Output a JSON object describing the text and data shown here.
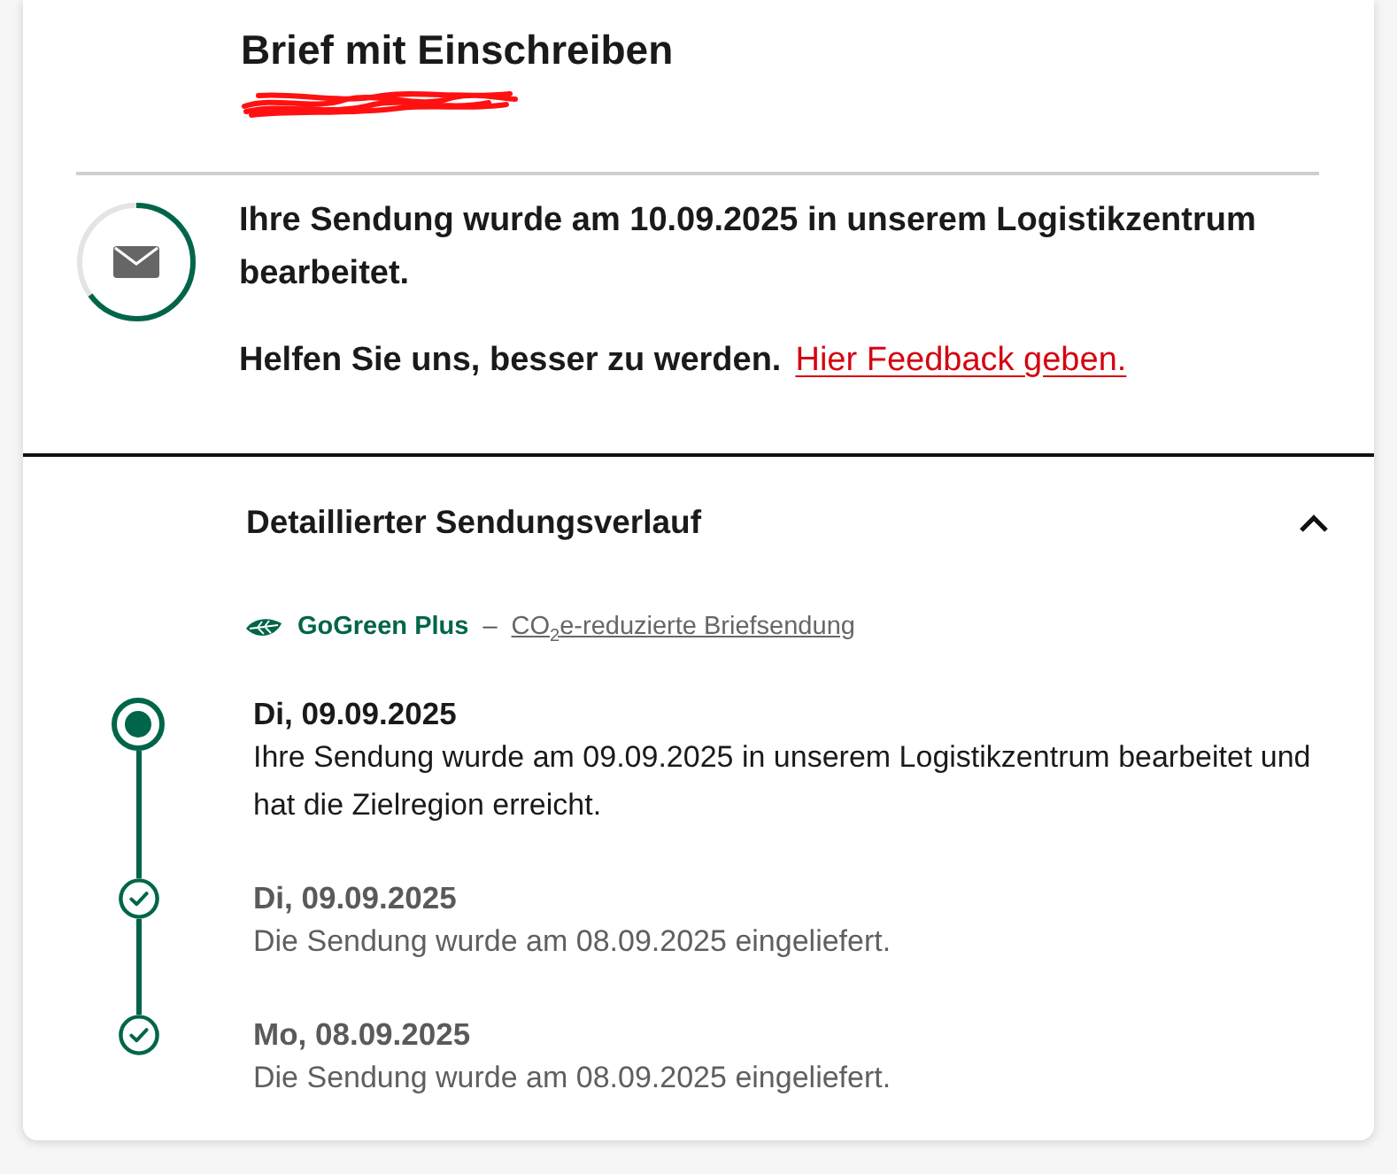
{
  "shipment": {
    "title": "Brief mit Einschreiben",
    "tracking_number": {
      "redacted": true
    }
  },
  "status": {
    "message": "Ihre Sendung wurde am 10.09.2025 in unserem Logistikzentrum bearbeitet.",
    "feedback_prompt": "Helfen Sie uns, besser zu werden.",
    "feedback_link": "Hier Feedback geben."
  },
  "history": {
    "title": "Detaillierter Sendungsverlauf",
    "expanded": true,
    "gogreen": {
      "label": "GoGreen Plus",
      "separator": "–",
      "link": "CO$_{2}$e-reduzierte Briefsendung"
    },
    "events": [
      {
        "date": "Di, 09.09.2025",
        "text": "Ihre Sendung wurde am 09.09.2025 in unserem Logistikzentrum bearbeitet und hat die Zielregion erreicht.",
        "current": true
      },
      {
        "date": "Di, 09.09.2025",
        "text": "Die Sendung wurde am 08.09.2025 eingeliefert.",
        "current": false
      },
      {
        "date": "Mo, 08.09.2025",
        "text": "Die Sendung wurde am 08.09.2025 eingeliefert.",
        "current": false
      }
    ]
  }
}
